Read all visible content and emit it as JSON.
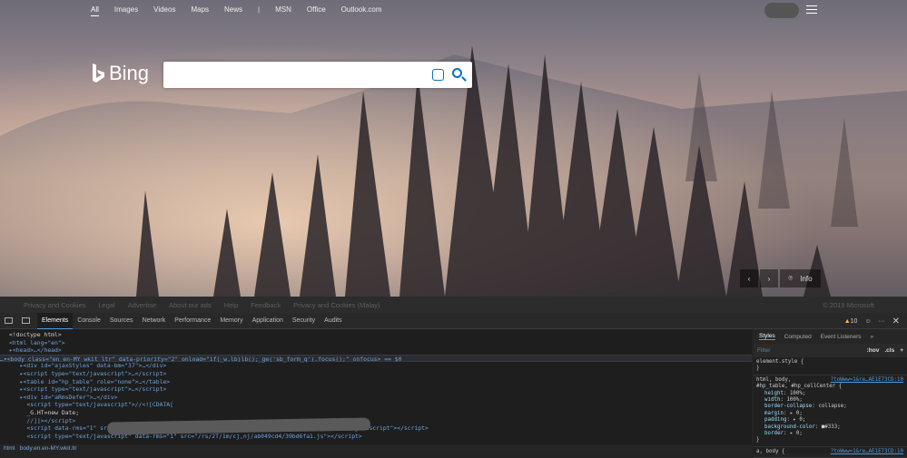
{
  "topnav": {
    "items": [
      "All",
      "Images",
      "Videos",
      "Maps",
      "News",
      "|",
      "MSN",
      "Office",
      "Outlook.com"
    ]
  },
  "logo": {
    "text": "Bing"
  },
  "search": {
    "value": "",
    "placeholder": ""
  },
  "carousel": {
    "info": "Info"
  },
  "footer": {
    "links": [
      "Privacy and Cookies",
      "Legal",
      "Advertise",
      "About our ads",
      "Help",
      "Feedback",
      "Privacy and Cookies (Malay)"
    ],
    "copyright": "© 2019 Microsoft"
  },
  "devtools": {
    "tabs": [
      "Elements",
      "Console",
      "Sources",
      "Network",
      "Performance",
      "Memory",
      "Application",
      "Security",
      "Audits"
    ],
    "warnings": "10",
    "code": [
      "<!doctype html>",
      "<html lang=\"en\">",
      "▸<head>…</head>",
      "…▾<body class=\"en en-MY wkit ltr\" data-priority=\"2\" onload=\"if(_w.lb)lb();_ge('sb_form_q').focus();\" onfocus> == $0",
      "  ▸<div id=\"ajaxStyles\" data-bm=\"37\">…</div>",
      "  ▸<script type=\"text/javascript\">…</script>",
      "  ▸<table id=\"hp_table\" role=\"none\">…</table>",
      "  ▸<script type=\"text/javascript\">…</script>",
      "  ▸<div id=\"aRmsDefer\">…</div>",
      "    <script type=\"text/javascript\">//<![CDATA[",
      "    _G.HT=new Date;",
      "    //]]></script>",
      "    <script data-rms=\"1\" src=\"/                                                      \" type=\"text/javascript\"></script>",
      "    <script type=\"text/javascript\" data-rms=\"1\" src=\"/rs/2T/1m/cj,nj/ab049cd4/39bd6fa1.js\"></script>"
    ],
    "breadcrumb": [
      "html",
      "body.en.en-MY.wkit.ltr"
    ],
    "styles": {
      "tabs": [
        "Styles",
        "Computed",
        "Event Listeners",
        "»"
      ],
      "filter_placeholder": "Filter",
      "hov": ":hov",
      "cls": ".cls",
      "plus": "+",
      "element_style": "element.style {",
      "close": "}",
      "rule1_selector": "html, body,",
      "rule1_selector2": "#hp_table, #hp_cellCenter {",
      "rule1_src": "?toWww=1&re…AE1E73CD:10",
      "props": [
        [
          "height",
          "100%;"
        ],
        [
          "width",
          "100%;"
        ],
        [
          "border-collapse",
          "collapse;"
        ],
        [
          "margin",
          "▸ 0;"
        ],
        [
          "padding",
          "▸ 0;"
        ],
        [
          "background-color",
          "■#333;"
        ],
        [
          "border",
          "▸ 0;"
        ]
      ],
      "rule2_selector": "a, body {",
      "rule2_src": "?toWww=1&re…AE1E73CD:10"
    }
  }
}
